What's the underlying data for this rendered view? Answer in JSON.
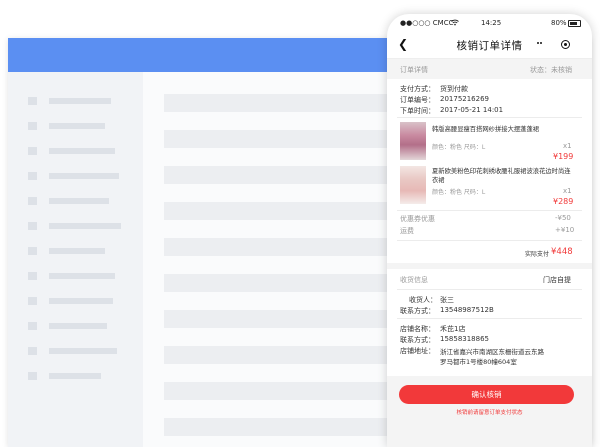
{
  "phone": {
    "status": {
      "carrier": "●●○○○ CMCC",
      "time": "14:25",
      "battery": "80%"
    },
    "title": "核销订单详情",
    "back": "❮",
    "order_section": {
      "label": "订单详情",
      "status_label": "状态：",
      "status_value": "未核销"
    },
    "order_info": [
      {
        "label": "支付方式：",
        "value": "货到付款"
      },
      {
        "label": "订单编号：",
        "value": "20175216269"
      },
      {
        "label": "下单时间：",
        "value": "2017-05-21  14:01"
      }
    ],
    "items": [
      {
        "title": "韩版高腰显瘦百搭网纱拼接大摆蓬蓬裙",
        "spec": "颜色：粉色    尺码：L",
        "qty": "x1",
        "price": "¥199"
      },
      {
        "title": "夏新欧美粉色印花刺绣收腰礼服裙波浪花边时尚连衣裙",
        "spec": "颜色：粉色    尺码：L",
        "qty": "x1",
        "price": "¥289"
      }
    ],
    "discounts": [
      {
        "label": "优惠券优惠",
        "value": "-¥50"
      },
      {
        "label": "运费",
        "value": "+¥10"
      }
    ],
    "total": {
      "label": "实际支付",
      "value": "¥448"
    },
    "receipt_section": {
      "label": "收货信息",
      "mode": "门店自提"
    },
    "receiver": [
      {
        "label": "收货人：",
        "value": "张三"
      },
      {
        "label": "联系方式：",
        "value": "13548987512B"
      }
    ],
    "store": [
      {
        "label": "店铺名称：",
        "value": "禾芘1店"
      },
      {
        "label": "联系方式：",
        "value": "15858318865"
      },
      {
        "label": "店铺地址：",
        "value": "浙江省嘉兴市南湖区东栅街道云东路"
      },
      {
        "label": "",
        "value": "罗马都市1号楼80幢604室"
      }
    ],
    "confirm_label": "确认核销",
    "footer_note": "核销前请留意订单支付状态"
  },
  "colors": {
    "accent": "#f2393a",
    "admin_header": "#5b8ff2"
  },
  "icons": [
    "back-arrow-icon",
    "more-dots-icon",
    "target-icon",
    "wifi-icon",
    "battery-icon"
  ]
}
